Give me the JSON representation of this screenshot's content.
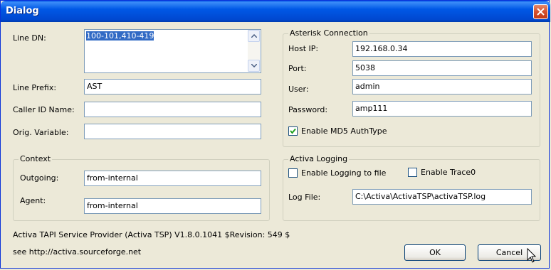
{
  "window": {
    "title": "Dialog"
  },
  "line": {
    "dn_label": "Line DN:",
    "dn_value": "100-101,410-419",
    "prefix_label": "Line Prefix:",
    "prefix_value": "AST",
    "caller_id_label": "Caller ID Name:",
    "caller_id_value": "",
    "orig_var_label": "Orig. Variable:",
    "orig_var_value": ""
  },
  "asterisk": {
    "title": "Asterisk Connection",
    "host_label": "Host IP:",
    "host_value": "192.168.0.34",
    "port_label": "Port:",
    "port_value": "5038",
    "user_label": "User:",
    "user_value": "admin",
    "password_label": "Password:",
    "password_value": "amp111",
    "md5_label": "Enable MD5 AuthType",
    "md5_checked": true
  },
  "context": {
    "title": "Context",
    "outgoing_label": "Outgoing:",
    "outgoing_value": "from-internal",
    "agent_label": "Agent:",
    "agent_value": "from-internal"
  },
  "logging": {
    "title": "Activa Logging",
    "enable_logging_label": "Enable Logging to file",
    "enable_logging_checked": false,
    "enable_trace_label": "Enable Trace0",
    "enable_trace_checked": false,
    "log_file_label": "Log File:",
    "log_file_value": "C:\\Activa\\ActivaTSP\\activaTSP.log"
  },
  "footer": {
    "version_text": "Activa TAPI Service Provider (Activa TSP)   V1.8.0.1041 $Revision: 549 $",
    "url_text": "see http://activa.sourceforge.net"
  },
  "buttons": {
    "ok": "OK",
    "cancel": "Cancel"
  },
  "icons": {
    "close": "close-icon",
    "scroll_up": "chevron-up-icon",
    "scroll_down": "chevron-down-icon",
    "check": "checkmark-icon"
  },
  "colors": {
    "titlebar": "#0058e6",
    "face": "#ece9d8",
    "selection": "#316ac5",
    "field_border": "#7f9db9"
  }
}
